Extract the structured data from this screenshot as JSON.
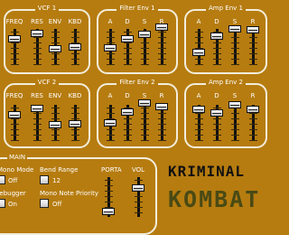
{
  "vcf1": {
    "title": "VCF 1",
    "labels": [
      "FREQ",
      "RES",
      "ENV",
      "KBD"
    ]
  },
  "filter_env1": {
    "title": "Filter Env 1",
    "labels": [
      "A",
      "D",
      "S",
      "R"
    ]
  },
  "amp_env1": {
    "title": "Amp Env 1",
    "labels": [
      "A",
      "D",
      "S",
      "R"
    ]
  },
  "vcf2": {
    "title": "VCF 2",
    "labels": [
      "FREQ",
      "RES",
      "ENV",
      "KBD"
    ]
  },
  "filter_env2": {
    "title": "Filter Env 2",
    "labels": [
      "A",
      "D",
      "S",
      "R"
    ]
  },
  "amp_env2": {
    "title": "Amp Env 2",
    "labels": [
      "A",
      "D",
      "S",
      "R"
    ]
  },
  "main": {
    "title": "MAIN",
    "mono_mode_label": "Mono Mode",
    "mono_mode_value": "Off",
    "bend_range_label": "Bend Range",
    "bend_range_value": "12",
    "debugger_label": "Debugger",
    "debugger_value": "On",
    "mono_note_priority_label": "Mono Note Priority",
    "mono_note_priority_value": "Off",
    "porta_label": "PORTA",
    "vol_label": "VOL"
  },
  "brand": {
    "line1": "KRIMINAL",
    "line2": "KOMBAT"
  },
  "colors": {
    "background": "#b67c10",
    "border": "#f3eddc",
    "brand_dark": "#111111",
    "brand_green": "#4a4a14"
  }
}
